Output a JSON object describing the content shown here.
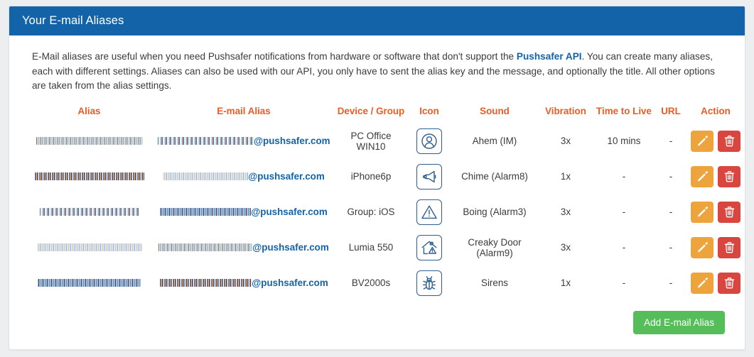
{
  "panel": {
    "title": "Your E-mail Aliases"
  },
  "intro": {
    "part1": "E-Mail aliases are useful when you need Pushsafer notifications from hardware or software that don't support the ",
    "link": "Pushsafer API",
    "part2": ". You can create many aliases, each with different settings. Aliases can also be used with our API, you only have to sent the alias key and the message, and optionally the title. All other options are taken from the alias settings."
  },
  "table": {
    "headers": {
      "alias": "Alias",
      "email": "E-mail Alias",
      "device": "Device / Group",
      "icon": "Icon",
      "sound": "Sound",
      "vibration": "Vibration",
      "ttl": "Time to Live",
      "url": "URL",
      "action": "Action"
    },
    "rows": [
      {
        "alias": "",
        "alias_redacted": true,
        "email_local": "",
        "email_local_redacted": true,
        "email_domain": "@pushsafer.com",
        "device": "PC Office WIN10",
        "icon": "user-icon",
        "sound": "Ahem (IM)",
        "vibration": "3x",
        "ttl": "10 mins",
        "url": "-"
      },
      {
        "alias": "",
        "alias_redacted": true,
        "email_local": "",
        "email_local_redacted": true,
        "email_domain": "@pushsafer.com",
        "device": "iPhone6p",
        "icon": "megaphone-icon",
        "sound": "Chime (Alarm8)",
        "vibration": "1x",
        "ttl": "-",
        "url": "-"
      },
      {
        "alias": "",
        "alias_redacted": true,
        "email_local": "",
        "email_local_redacted": true,
        "email_domain": "@pushsafer.com",
        "device": "Group: iOS",
        "icon": "warning-triangle-icon",
        "sound": "Boing (Alarm3)",
        "vibration": "3x",
        "ttl": "-",
        "url": "-"
      },
      {
        "alias": "",
        "alias_redacted": true,
        "email_local": "",
        "email_local_redacted": true,
        "email_domain": "@pushsafer.com",
        "device": "Lumia 550",
        "icon": "home-alarm-icon",
        "sound": "Creaky Door (Alarm9)",
        "vibration": "3x",
        "ttl": "-",
        "url": "-"
      },
      {
        "alias": "",
        "alias_redacted": true,
        "email_local": "",
        "email_local_redacted": true,
        "email_domain": "@pushsafer.com",
        "device": "BV2000s",
        "icon": "bug-icon",
        "sound": "Sirens",
        "vibration": "1x",
        "ttl": "-",
        "url": "-"
      }
    ],
    "action_icons": {
      "edit": "pencil-icon",
      "delete": "trash-icon"
    }
  },
  "footer": {
    "add_button": "Add E-mail Alias"
  },
  "colors": {
    "header_bar": "#1363a8",
    "table_header_text": "#ec5c22",
    "link": "#1363a8",
    "edit_button": "#eda43c",
    "delete_button": "#d9453f",
    "add_button": "#56bd5b",
    "page_background": "#eceef0"
  }
}
